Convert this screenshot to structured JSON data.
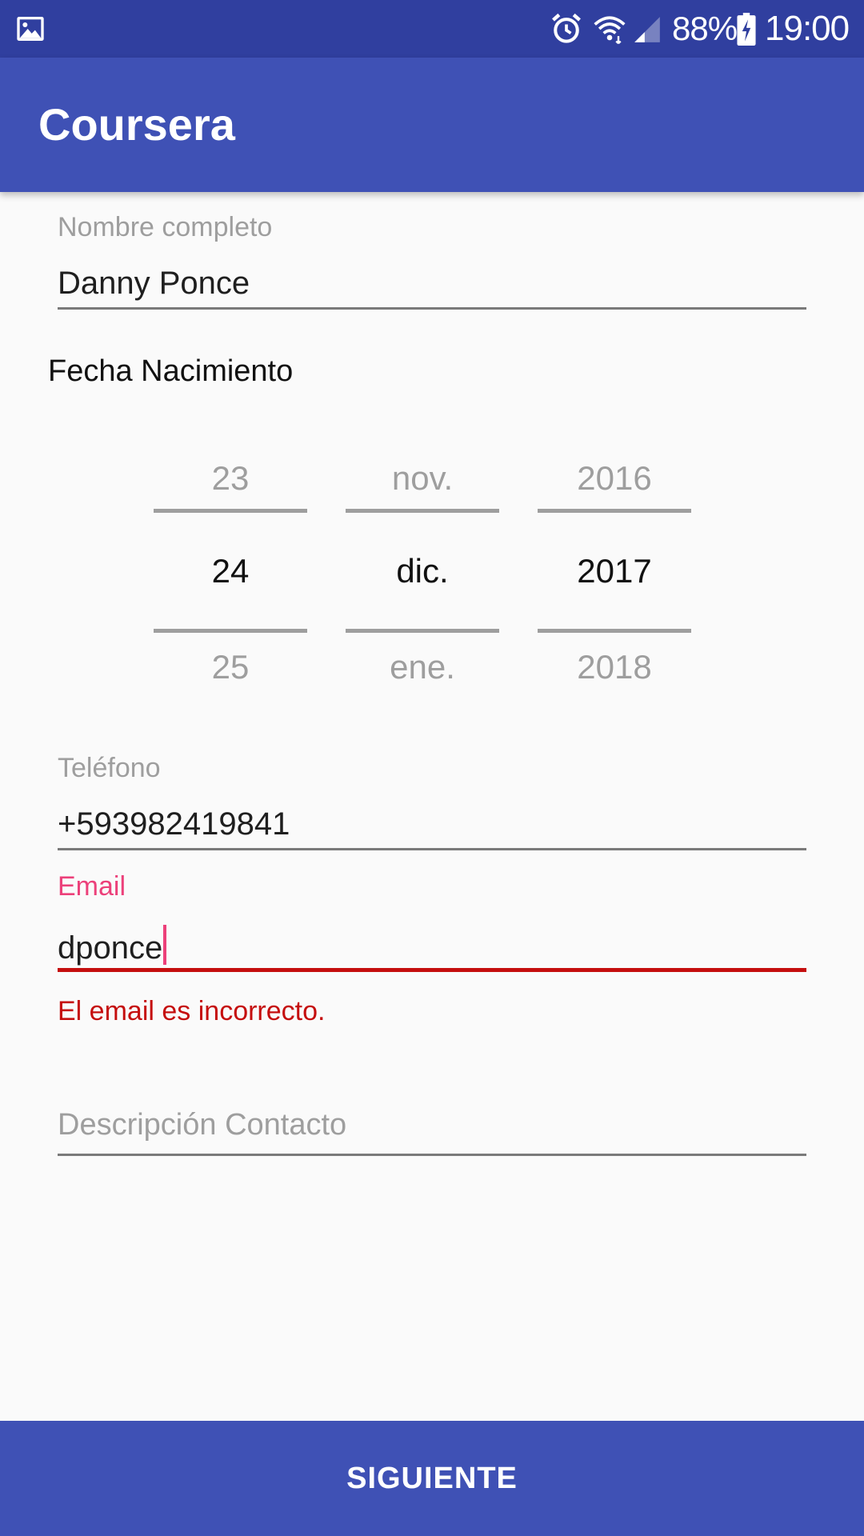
{
  "status_bar": {
    "battery": "88%",
    "time": "19:00",
    "icons": [
      "gallery-icon",
      "alarm-icon",
      "wifi-icon",
      "signal-icon",
      "battery-charging-icon"
    ]
  },
  "app_bar": {
    "title": "Coursera"
  },
  "form": {
    "name": {
      "label": "Nombre completo",
      "value": "Danny Ponce"
    },
    "birth_date": {
      "label": "Fecha Nacimiento",
      "day": {
        "prev": "23",
        "selected": "24",
        "next": "25"
      },
      "month": {
        "prev": "nov.",
        "selected": "dic.",
        "next": "ene."
      },
      "year": {
        "prev": "2016",
        "selected": "2017",
        "next": "2018"
      }
    },
    "phone": {
      "label": "Teléfono",
      "value": "+593982419841"
    },
    "email": {
      "label": "Email",
      "value": "dponce",
      "error": "El email es incorrecto."
    },
    "description": {
      "hint": "Descripción Contacto",
      "value": ""
    }
  },
  "next_button": {
    "label": "SIGUIENTE"
  },
  "colors": {
    "status_bar": "#303f9f",
    "primary": "#3f51b5",
    "accent": "#ec407a",
    "error": "#c50e0e"
  }
}
